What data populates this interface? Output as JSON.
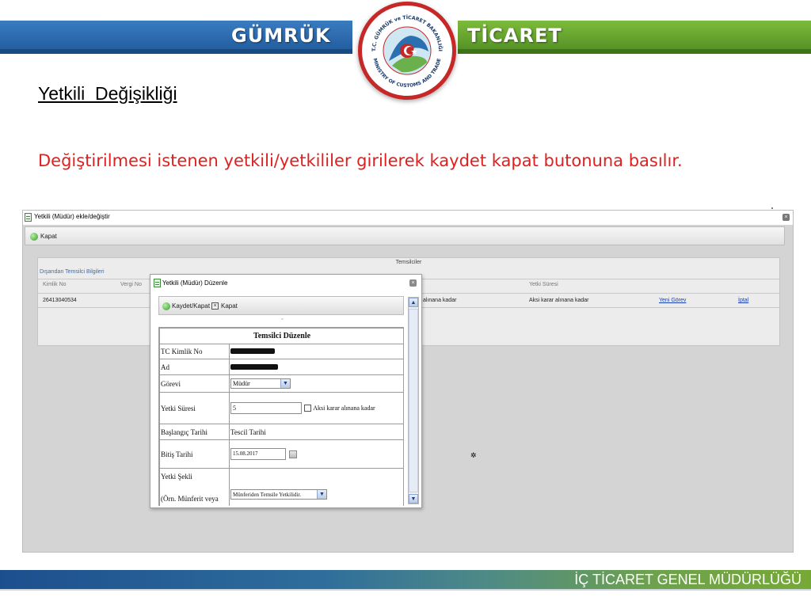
{
  "banner": {
    "left_text": "GÜMRÜK",
    "right_text": "TİCARET",
    "seal_top": "T.C. GÜMRÜK ve TİCARET BAKANLIĞI",
    "seal_bottom": "MINISTRY OF CUSTOMS AND TRADE"
  },
  "slide": {
    "title": "Yetkili  Değişikliği",
    "body": "Değiştirilmesi istenen yetkili/yetkililer girilerek kaydet kapat butonuna basılır."
  },
  "app": {
    "window_title": "Yetkili (Müdür) ekle/değiştir",
    "toolbar": {
      "kapat_label": "Kapat"
    },
    "panel": {
      "header": "Temsilciler",
      "subheader": "Dışarıdan Temsilci Bilgileri",
      "columns": {
        "kimlik_no": "Kimlik No",
        "vergi_no": "Vergi No",
        "yetki_suresi": "Yetki Süresi"
      },
      "row": {
        "kimlik_no": "26413040534",
        "status": "alınana kadar",
        "yetki_suresi": "Aksi karar alınana kadar",
        "yeni_gorev": "Yeni Görev",
        "iptal": "İptal"
      }
    }
  },
  "dialog": {
    "title": "Yetkili (Müdür) Düzenle",
    "toolbar": {
      "kaydet_kapat_label": "Kaydet/Kapat",
      "kapat_label": "Kapat"
    },
    "form": {
      "header": "Temsilci Düzenle",
      "tc_kimlik_label": "TC Kimlik No",
      "ad_label": "Ad",
      "gorevi_label": "Görevi",
      "gorevi_value": "Müdür",
      "yetki_suresi_label": "Yetki Süresi",
      "yetki_suresi_value": "5",
      "aksi_karar_label": "Aksi karar alınana kadar",
      "baslangic_label": "Başlangıç Tarihi",
      "baslangic_value": "Tescil Tarihi",
      "bitis_label": "Bitiş Tarihi",
      "bitis_value": "15.08.2017",
      "yetki_sekli_label": "Yetki Şekli",
      "yetki_sekli_note": "(Örn. Münferit veya",
      "yetki_sekli_value": "Münferiden Temsile Yetkilidir."
    }
  },
  "footer": {
    "text": "İÇ TİCARET GENEL MÜDÜRLÜĞÜ"
  },
  "colors": {
    "banner_blue": "#1f5a9c",
    "banner_green": "#4f8c22",
    "accent_red": "#e0201e",
    "seal_red": "#c62828"
  }
}
